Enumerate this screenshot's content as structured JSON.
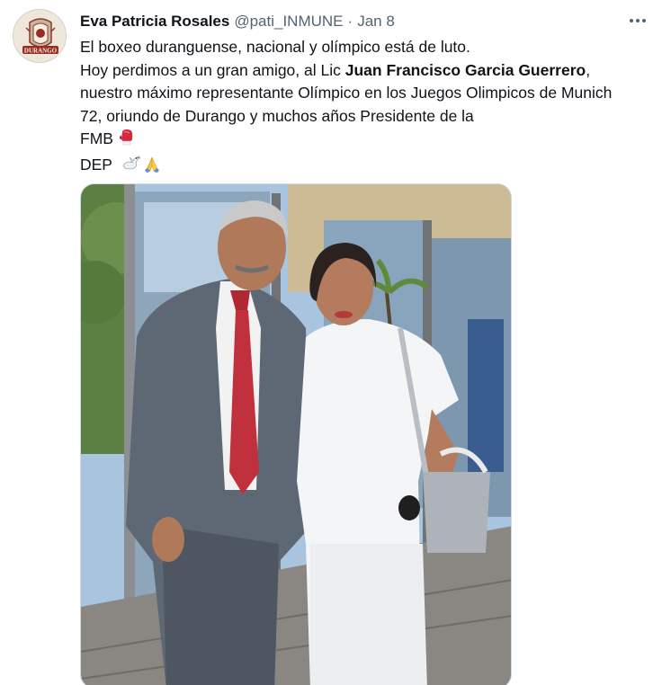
{
  "tweet": {
    "author": {
      "name": "Eva Patricia Rosales",
      "handle": "@pati_INMUNE",
      "avatar_text": "DURANGO"
    },
    "separator": "·",
    "date": "Jan 8",
    "text": {
      "line1": "El boxeo duranguense, nacional y olímpico está de luto.",
      "line2_before": "Hoy perdimos a un gran amigo, al Lic ",
      "line2_bold": "Juan Francisco Garcia Guerrero",
      "line2_after": ",",
      "line3": "nuestro máximo representante Olímpico en los Juegos Olimpicos de Munich",
      "line4": "72, oriundo de Durango y muchos años Presidente de la",
      "line5": "FMB",
      "line6": "DEP"
    },
    "emojis": [
      "boxing-glove-icon",
      "dove-icon",
      "folded-hands-icon"
    ],
    "more_icon": "more-horizontal-icon",
    "media": "photo of a man in a grey suit and a woman in white in front of a glass building"
  },
  "colors": {
    "text": "#0f1419",
    "secondary": "#536471",
    "border": "#cfd9de"
  }
}
